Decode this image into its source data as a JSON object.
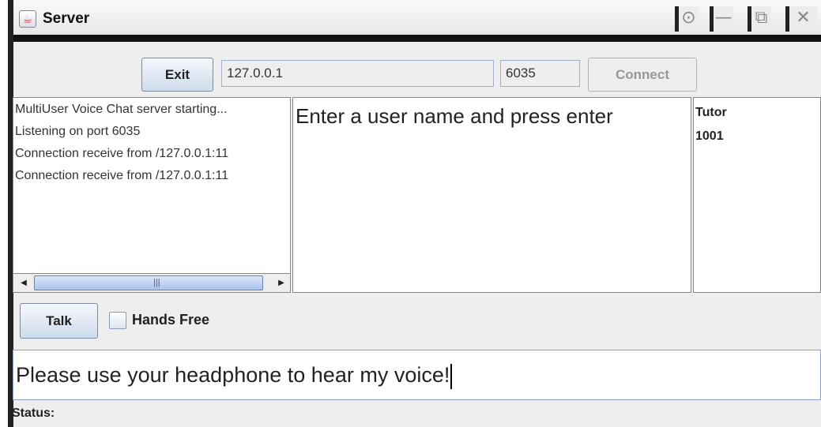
{
  "window": {
    "title": "Server",
    "controls": [
      "restore-icon",
      "minimize-icon",
      "maximize-icon",
      "close-icon"
    ]
  },
  "toolbar": {
    "exit_label": "Exit",
    "host_value": "127.0.0.1",
    "port_value": "6035",
    "connect_label": "Connect",
    "connect_enabled": false
  },
  "log": {
    "lines": [
      "MultiUser Voice Chat server starting...",
      "Listening on port 6035",
      "Connection receive from /127.0.0.1:11",
      "Connection receive from /127.0.0.1:11"
    ]
  },
  "message_area": {
    "prompt": "Enter a user name and press enter"
  },
  "users": {
    "items": [
      "Tutor",
      "1001"
    ]
  },
  "controls": {
    "talk_label": "Talk",
    "hands_free_label": "Hands Free",
    "hands_free_checked": false
  },
  "input": {
    "value": "Please use your headphone to hear my voice!"
  },
  "status": {
    "label": "Status:"
  },
  "colors": {
    "button_top": "#f4f8fc",
    "button_bottom": "#cfdcec",
    "field_border": "#9eb0c8",
    "scroll_thumb": "#a9c3ee",
    "window_bg": "#eeeeee"
  }
}
